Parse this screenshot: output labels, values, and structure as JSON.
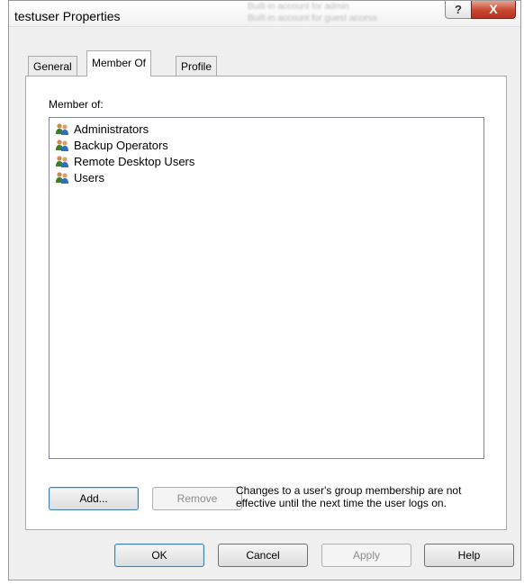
{
  "window": {
    "title": "testuser Properties",
    "help_glyph": "?",
    "close_glyph": "X",
    "background_text": [
      "Built-in account for admin",
      "Built-in account for guest access"
    ]
  },
  "tabs": [
    {
      "label": "General",
      "active": false
    },
    {
      "label": "Member Of",
      "active": true
    },
    {
      "label": "Profile",
      "active": false
    }
  ],
  "member_of": {
    "label": "Member of:",
    "groups": [
      "Administrators",
      "Backup Operators",
      "Remote Desktop Users",
      "Users"
    ],
    "add_label": "Add...",
    "remove_label": "Remove",
    "note": "Changes to a user's group membership are not effective until the next time the user logs on."
  },
  "footer": {
    "ok_label": "OK",
    "cancel_label": "Cancel",
    "apply_label": "Apply",
    "help_label": "Help"
  },
  "icons": {
    "group": "group-users-icon",
    "help": "help-icon",
    "close": "close-icon"
  }
}
